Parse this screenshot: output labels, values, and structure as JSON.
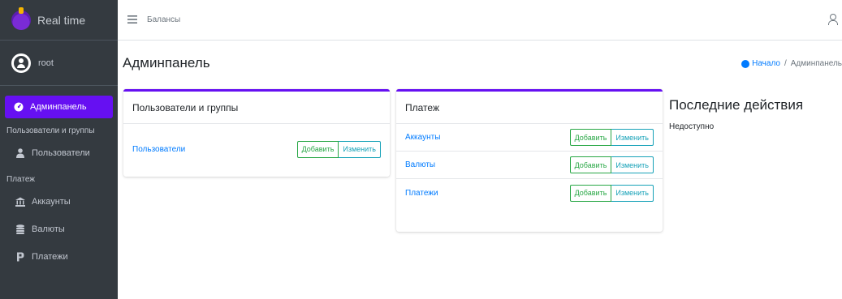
{
  "brand": {
    "name": "Real time"
  },
  "user": {
    "name": "root"
  },
  "sidebar": {
    "active": {
      "label": "Админпанель",
      "icon": "tachometer-icon"
    },
    "groups": [
      {
        "header": "Пользователи и группы",
        "items": [
          {
            "label": "Пользователи",
            "icon": "user-icon"
          }
        ]
      },
      {
        "header": "Платеж",
        "items": [
          {
            "label": "Аккаунты",
            "icon": "bank-icon"
          },
          {
            "label": "Валюты",
            "icon": "coins-icon"
          },
          {
            "label": "Платежи",
            "icon": "money-icon"
          }
        ]
      }
    ]
  },
  "topbar": {
    "menu_icon": "menu-icon",
    "title": "Балансы",
    "user_icon": "user-icon"
  },
  "page": {
    "title": "Админпанель"
  },
  "breadcrumb": {
    "home": "Начало",
    "separator": "/",
    "current": "Админпанель"
  },
  "cards": {
    "users_groups": {
      "title": "Пользователи и группы",
      "rows": [
        {
          "label": "Пользователи",
          "add": "Добавить",
          "edit": "Изменить"
        }
      ]
    },
    "payment": {
      "title": "Платеж",
      "rows": [
        {
          "label": "Аккаунты",
          "add": "Добавить",
          "edit": "Изменить"
        },
        {
          "label": "Валюты",
          "add": "Добавить",
          "edit": "Изменить"
        },
        {
          "label": "Платежи",
          "add": "Добавить",
          "edit": "Изменить"
        }
      ]
    }
  },
  "recent": {
    "title": "Последние действия",
    "text": "Недоступно"
  },
  "colors": {
    "accent": "#6610f2",
    "sidebar": "#343a40",
    "link": "#007bff",
    "add": "#28a745",
    "edit": "#17a2b8"
  }
}
